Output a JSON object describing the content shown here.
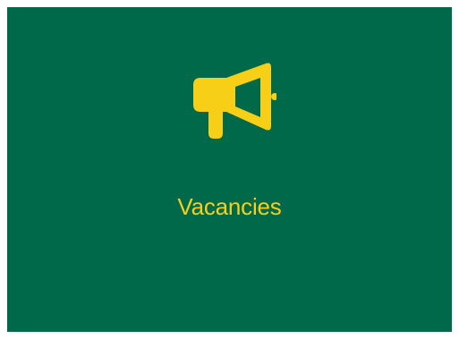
{
  "tile": {
    "label": "Vacancies",
    "icon": "megaphone-icon",
    "background_color": "#00694a",
    "accent_color": "#f7cf17"
  }
}
